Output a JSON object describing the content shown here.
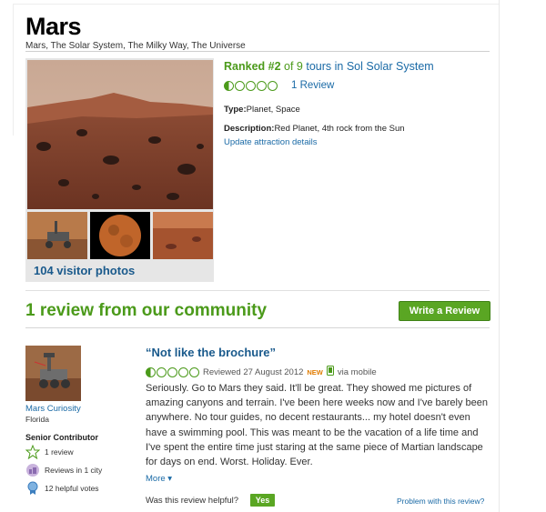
{
  "attraction": {
    "name": "Mars",
    "breadcrumb": "Mars, The Solar System, The Milky Way, The Universe",
    "ranked_label": "Ranked #2",
    "ranked_of": "of 9",
    "ranked_link": "tours in Sol Solar System",
    "rating": 0.5,
    "rating_max": 5,
    "review_count": "1 Review",
    "type_label": "Type:",
    "type_value": "Planet, Space",
    "description_label": "Description:",
    "description_value": "Red Planet, 4th rock from the Sun",
    "update_link": "Update attraction details",
    "photos_link": "104 visitor photos"
  },
  "reviews_section": {
    "title": "1 review from our community",
    "write_button": "Write a Review"
  },
  "review": {
    "reviewer_name": "Mars Curiosity",
    "reviewer_location": "Florida",
    "contributor_level": "Senior Contributor",
    "badges": [
      {
        "icon": "star-outline-icon",
        "label": "1 review"
      },
      {
        "icon": "cities-icon",
        "label": "Reviews in 1 city"
      },
      {
        "icon": "helpful-votes-icon",
        "label": "12 helpful votes"
      }
    ],
    "title": "“Not like the brochure”",
    "rating": 0.5,
    "date": "Reviewed 27 August 2012",
    "new_badge": "NEW",
    "via": "via mobile",
    "body": "Seriously. Go to Mars they said. It'll be great. They showed me pictures of amazing canyons and terrain. I've been here weeks now and I've barely been anywhere. No tour guides, no decent restaurants... my hotel doesn't even have a swimming pool. This was meant to be the vacation of a life time and I've spent the entire time just staring at the same piece of Martian landscape for days on end. Worst. Holiday. Ever.",
    "more_link": "More",
    "helpful_prompt": "Was this review helpful?",
    "yes_button": "Yes",
    "problem_link": "Problem with this review?"
  },
  "colors": {
    "accent_green": "#4b9a1a",
    "link_blue": "#1a6aa6",
    "new_orange": "#e07b00"
  }
}
